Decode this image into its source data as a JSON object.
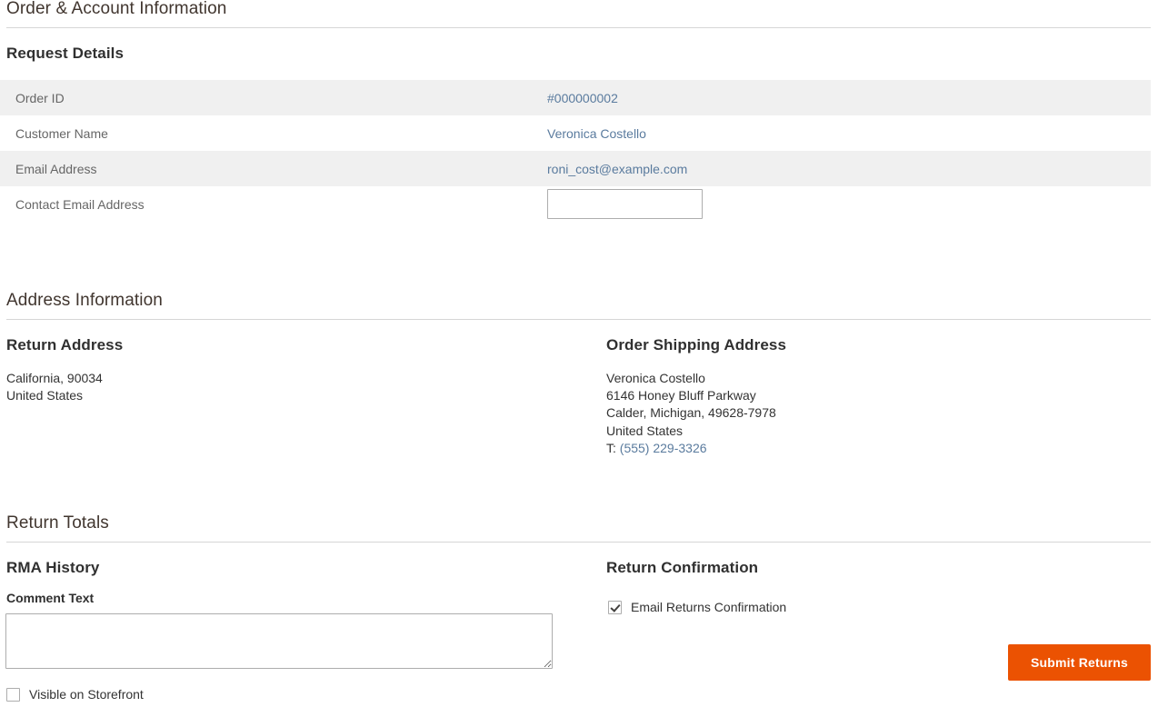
{
  "sections": {
    "order_account": {
      "legend": "Order & Account Information",
      "subhead": "Request Details",
      "rows": [
        {
          "label": "Order ID",
          "value": "#000000002",
          "type": "link"
        },
        {
          "label": "Customer Name",
          "value": "Veronica Costello",
          "type": "link"
        },
        {
          "label": "Email Address",
          "value": "roni_cost@example.com",
          "type": "link"
        },
        {
          "label": "Contact Email Address",
          "value": "",
          "placeholder": "",
          "type": "input"
        }
      ]
    },
    "address_information": {
      "legend": "Address Information",
      "return_address": {
        "title": "Return Address",
        "lines": [
          "California, 90034",
          "United States"
        ]
      },
      "shipping_address": {
        "title": "Order Shipping Address",
        "lines": [
          "Veronica Costello",
          "6146 Honey Bluff Parkway",
          "Calder, Michigan, 49628-7978",
          "United States"
        ],
        "phone_prefix": "T:",
        "phone": "(555) 229-3326"
      }
    },
    "return_totals": {
      "legend": "Return Totals"
    },
    "rma_history": {
      "subhead": "RMA History",
      "comment_label": "Comment Text",
      "comment_value": "",
      "visible_storefront": {
        "label": "Visible on Storefront",
        "checked": false
      }
    },
    "return_confirmation": {
      "subhead": "Return Confirmation",
      "email_confirmation": {
        "label": "Email Returns Confirmation",
        "checked": true
      },
      "submit_label": "Submit Returns"
    }
  },
  "colors": {
    "accent_orange": "#eb5202",
    "link_blue": "#5a7b9e",
    "stripe_gray": "#f0f0f0",
    "heading_dark": "#303030",
    "label_gray": "#666666",
    "rule_gray": "#d6d6d6"
  }
}
